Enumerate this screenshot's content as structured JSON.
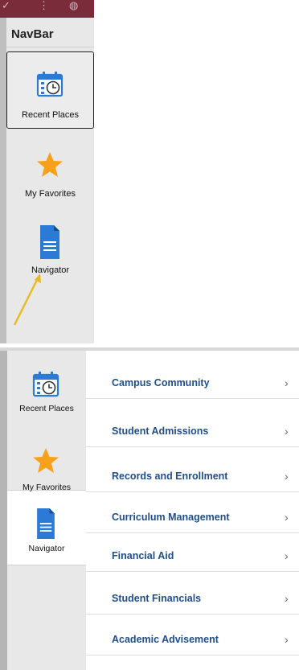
{
  "navbar": {
    "title": "NavBar"
  },
  "tiles": {
    "recent_places": {
      "label": "Recent Places",
      "icon": "calendar-clock-icon"
    },
    "my_favorites": {
      "label": "My Favorites",
      "icon": "star-icon"
    },
    "navigator": {
      "label": "Navigator",
      "icon": "document-icon"
    }
  },
  "menu": [
    {
      "label": "Campus Community"
    },
    {
      "label": "Student Admissions"
    },
    {
      "label": "Records and Enrollment"
    },
    {
      "label": "Curriculum Management"
    },
    {
      "label": "Financial Aid"
    },
    {
      "label": "Student Financials"
    },
    {
      "label": "Academic Advisement"
    }
  ],
  "chevron": "›",
  "colors": {
    "header": "#7b2c3b",
    "panel": "#e8e8e8",
    "link": "#1f4e8a",
    "star": "#f7a11a",
    "doc": "#2b7ad6",
    "arrow": "#e8b923"
  }
}
